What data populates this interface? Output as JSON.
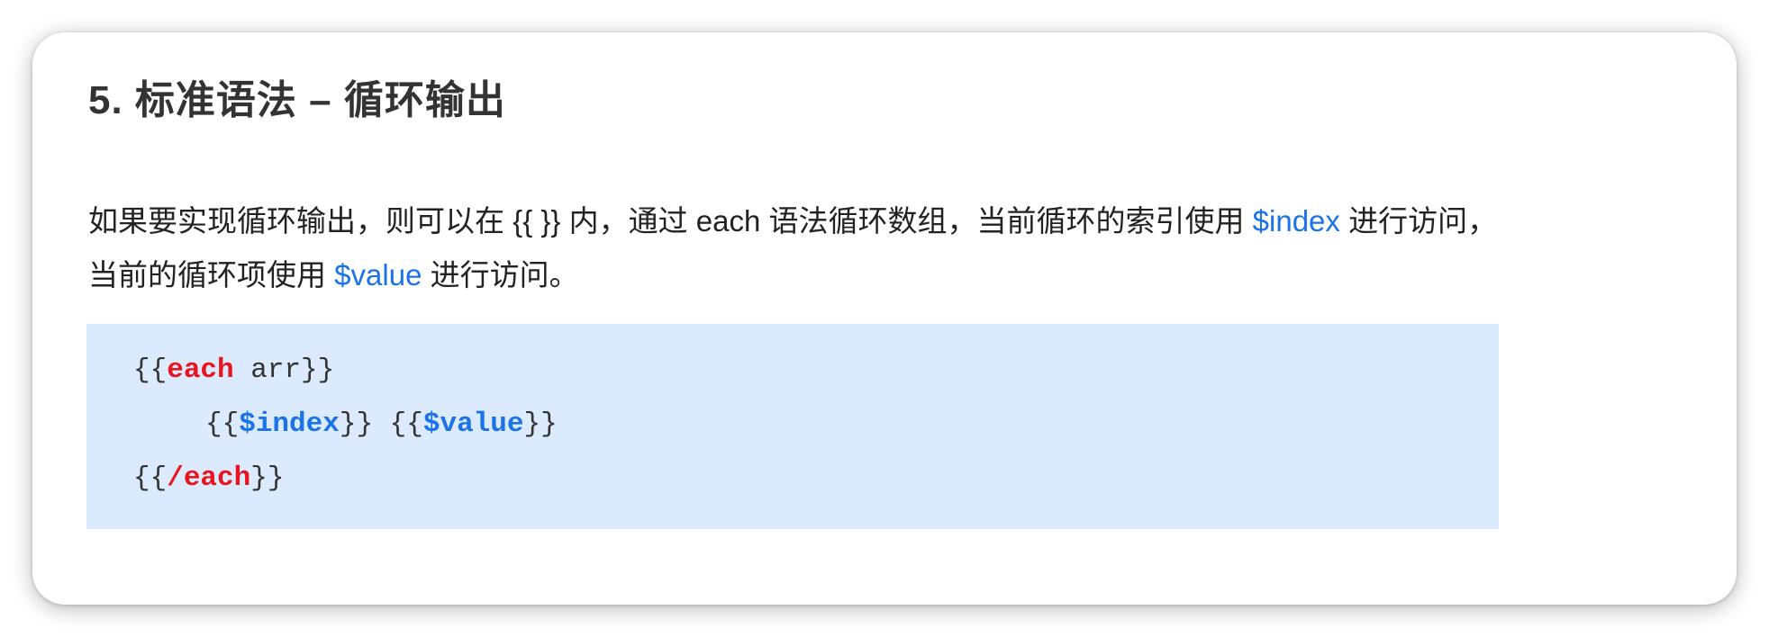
{
  "section": {
    "title": "5. 标准语法 – 循环输出"
  },
  "paragraph": {
    "part1": "如果要实现循环输出，则可以在 {{ }} 内，通过 each 语法循环数组，当前循环的索引使用 ",
    "index_var": "$index",
    "part2": " 进行访问，",
    "part3": "当前的循环项使用 ",
    "value_var": "$value",
    "part4": " 进行访问。"
  },
  "code": {
    "line1": {
      "open": "{{",
      "keyword": "each",
      "rest": " arr}}"
    },
    "line2": {
      "open1": "{{",
      "index_var": "$index",
      "mid": "}} {{",
      "value_var": "$value",
      "close": "}}"
    },
    "line3": {
      "open": "{{",
      "keyword": "/each",
      "close": "}}"
    }
  },
  "colors": {
    "keyword": "#e8141f",
    "variable": "#1a73e8",
    "code_background": "#dbeafd"
  }
}
